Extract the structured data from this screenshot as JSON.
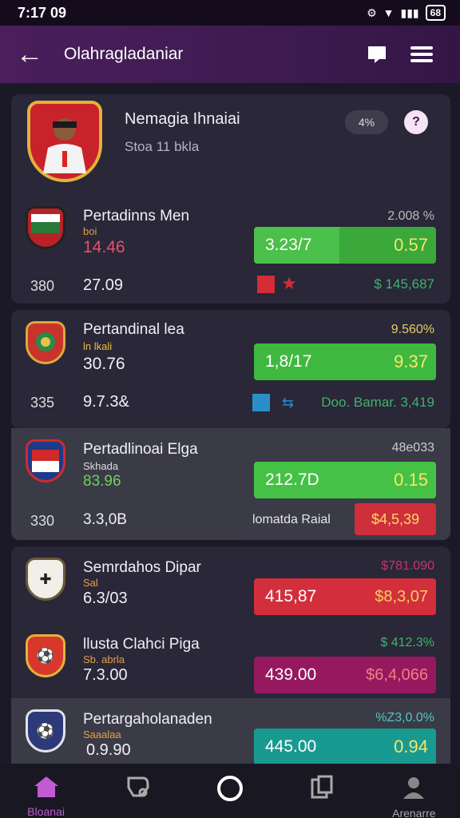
{
  "status": {
    "time": "7:17 09",
    "battery": "68"
  },
  "header": {
    "title": "Olahragladaniar"
  },
  "profile": {
    "name": "Nemagia Ihnaiai",
    "subtitle": "Stoa 11 bkla",
    "badge": "4%",
    "help": "?"
  },
  "matches": [
    {
      "name": "Pertadinns Men",
      "sub": "boi",
      "score": "14.46",
      "left": "380",
      "mid": "27.09",
      "pct": "2.008 %",
      "bar_left": "3.23/7",
      "bar_right": "0.57",
      "extra": "$ 145,687",
      "logo_text": "⚽"
    },
    {
      "name": "Pertandinal lea",
      "sub": "ln lkali",
      "score": "30.76",
      "left": "335",
      "mid": "9.7.3&",
      "pct": "9.560%",
      "bar_left": "1,8/17",
      "bar_right": "9.37",
      "extra": "Doo. Bamar. 3,419",
      "logo_text": "⚽"
    },
    {
      "name": "Pertadlinoai Elga",
      "sub": "Skhada",
      "score": "83.96",
      "left": "330",
      "mid": "3.3,0B",
      "pct": "48e033",
      "bar_left": "212.7D",
      "bar_right": "0.15",
      "extra_label": "lomatda Raial",
      "extra_value": "$4,5,39",
      "logo_text": "⚽"
    },
    {
      "name": "Semrdahos Dipar",
      "sub": "Sal",
      "score": "6.3/03",
      "pct": "$781.090",
      "bar_left": "415,87",
      "bar_right": "$8,3,07",
      "logo_text": "✚"
    },
    {
      "name": "llusta Clahci Piga",
      "sub": "Sb. abrla",
      "score": "7.3.00",
      "pct": "$ 412.3%",
      "bar_left": "439.00",
      "bar_right": "$6,4,066",
      "logo_text": "⚽"
    },
    {
      "name": "Pertargaholanaden",
      "sub": "Saaalaa",
      "score": "0.9.90",
      "pct": "%Z3,0.0%",
      "bar_left": "445.00",
      "bar_right": "0.94",
      "logo_text": "⚽"
    }
  ],
  "nav": [
    {
      "label": "Bloanai",
      "icon": "home-icon"
    },
    {
      "label": "",
      "icon": "ticket-icon"
    },
    {
      "label": "",
      "icon": "record-icon"
    },
    {
      "label": "",
      "icon": "copy-icon"
    },
    {
      "label": "Arenarre",
      "icon": "user-icon"
    }
  ],
  "colors": {
    "accent": "#6fd25a",
    "primary": "#4a1f5c",
    "green": "#4bc04a",
    "red": "#cf2f3b",
    "teal": "#199a91",
    "magenta": "#96195f"
  }
}
